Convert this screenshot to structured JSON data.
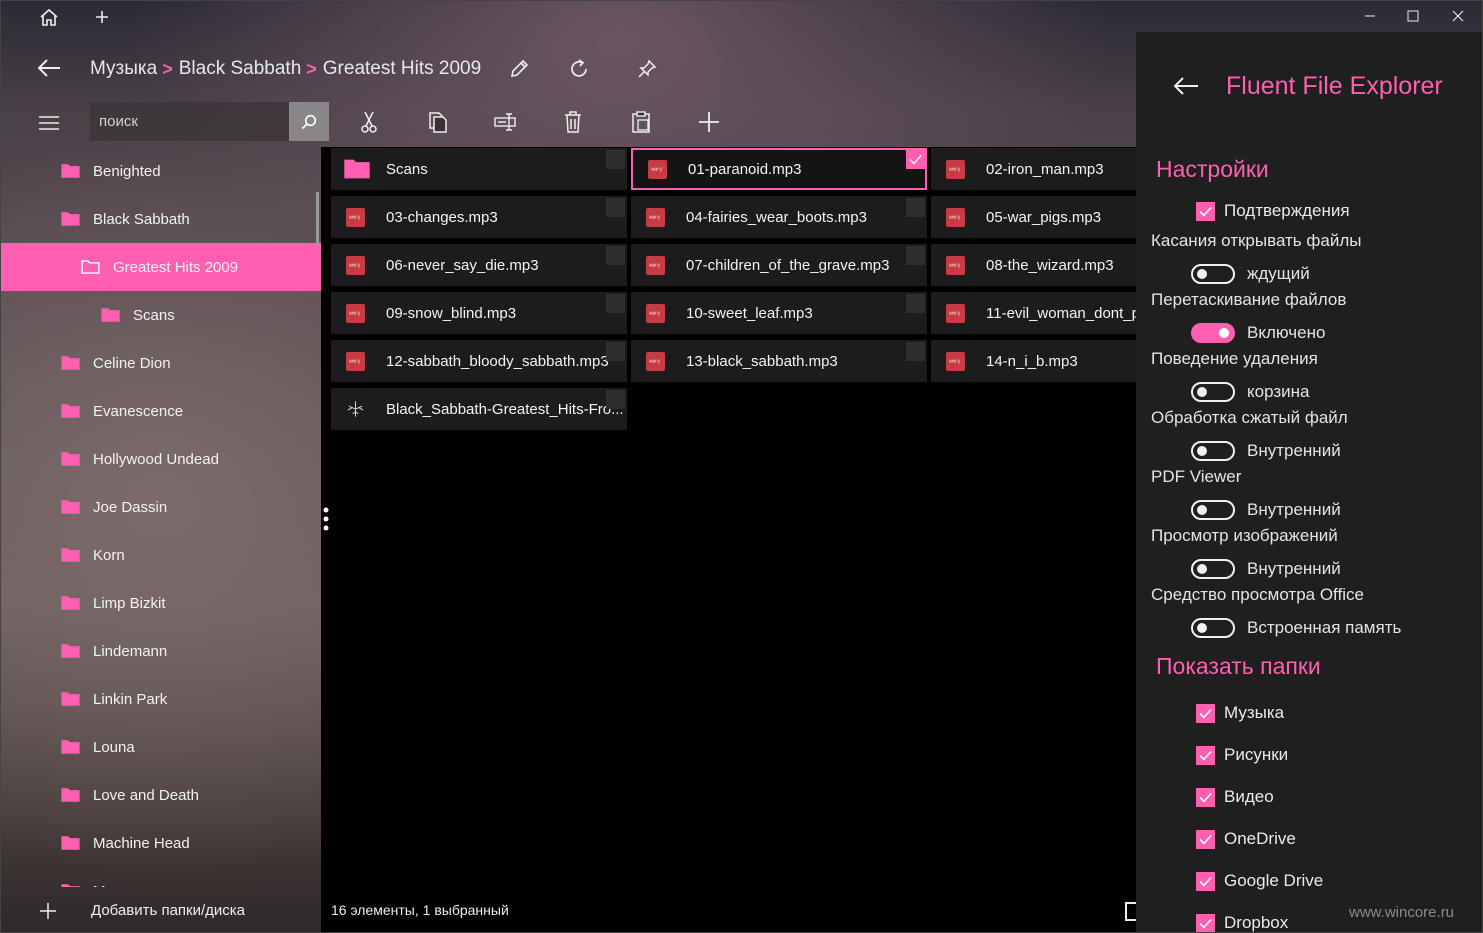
{
  "colors": {
    "accent": "#ff5fb0",
    "mp3_badge": "#c83a44",
    "panel_bg": "#1f1f1f",
    "tile_bg": "#1c1c1c"
  },
  "header": {
    "breadcrumb": [
      "Музыка",
      "Black Sabbath",
      "Greatest Hits 2009"
    ],
    "icons": [
      "home-icon",
      "new-tab-icon",
      "back-arrow-icon",
      "rename-icon",
      "refresh-icon",
      "pin-icon"
    ]
  },
  "toolbar": {
    "search_placeholder": "поиск",
    "icons": [
      "cut-icon",
      "copy-icon",
      "rename-item-icon",
      "delete-icon",
      "paste-icon",
      "add-icon"
    ]
  },
  "sidebar": {
    "items": [
      {
        "label": "Benighted",
        "level": 0
      },
      {
        "label": "Black Sabbath",
        "level": 0
      },
      {
        "label": "Greatest Hits 2009",
        "level": 1,
        "selected": true
      },
      {
        "label": "Scans",
        "level": 2
      },
      {
        "label": "Celine Dion",
        "level": 0
      },
      {
        "label": "Evanescence",
        "level": 0
      },
      {
        "label": "Hollywood Undead",
        "level": 0
      },
      {
        "label": "Joe Dassin",
        "level": 0
      },
      {
        "label": "Korn",
        "level": 0
      },
      {
        "label": "Limp Bizkit",
        "level": 0
      },
      {
        "label": "Lindemann",
        "level": 0
      },
      {
        "label": "Linkin Park",
        "level": 0
      },
      {
        "label": "Louna",
        "level": 0
      },
      {
        "label": "Love and Death",
        "level": 0
      },
      {
        "label": "Machine Head",
        "level": 0
      },
      {
        "label": "Manowar",
        "level": 0
      }
    ],
    "add_label": "Добавить папки/диска"
  },
  "files": [
    {
      "name": "Scans",
      "type": "folder"
    },
    {
      "name": "01-paranoid.mp3",
      "type": "mp3",
      "selected": true
    },
    {
      "name": "02-iron_man.mp3",
      "type": "mp3"
    },
    {
      "name": "03-changes.mp3",
      "type": "mp3"
    },
    {
      "name": "04-fairies_wear_boots.mp3",
      "type": "mp3"
    },
    {
      "name": "05-war_pigs.mp3",
      "type": "mp3"
    },
    {
      "name": "06-never_say_die.mp3",
      "type": "mp3"
    },
    {
      "name": "07-children_of_the_grave.mp3",
      "type": "mp3"
    },
    {
      "name": "08-the_wizard.mp3",
      "type": "mp3"
    },
    {
      "name": "09-snow_blind.mp3",
      "type": "mp3"
    },
    {
      "name": "10-sweet_leaf.mp3",
      "type": "mp3"
    },
    {
      "name": "11-evil_woman_dont_p",
      "type": "mp3"
    },
    {
      "name": "12-sabbath_bloody_sabbath.mp3",
      "type": "mp3"
    },
    {
      "name": "13-black_sabbath.mp3",
      "type": "mp3"
    },
    {
      "name": "14-n_i_b.mp3",
      "type": "mp3"
    },
    {
      "name": "Black_Sabbath-Greatest_Hits-Fro...",
      "type": "image"
    }
  ],
  "status": "16 элементы, 1 выбранный",
  "settings": {
    "title": "Fluent File Explorer",
    "section_settings": "Настройки",
    "confirmations_label": "Подтверждения",
    "rows": [
      {
        "label": "Касания открывать файлы",
        "value": "ждущий",
        "on": false
      },
      {
        "label": "Перетаскивание файлов",
        "value": "Включено",
        "on": true
      },
      {
        "label": "Поведение удаления",
        "value": "корзина",
        "on": false
      },
      {
        "label": "Обработка сжатый файл",
        "value": "Внутренний",
        "on": false
      },
      {
        "label": "PDF Viewer",
        "value": "Внутренний",
        "on": false
      },
      {
        "label": "Просмотр изображений",
        "value": "Внутренний",
        "on": false
      },
      {
        "label": "Средство просмотра Office",
        "value": "Встроенная память",
        "on": false
      }
    ],
    "section_folders": "Показать папки",
    "folders": [
      "Музыка",
      "Рисунки",
      "Видео",
      "OneDrive",
      "Google Drive",
      "Dropbox"
    ]
  },
  "watermark": "www.wincore.ru"
}
